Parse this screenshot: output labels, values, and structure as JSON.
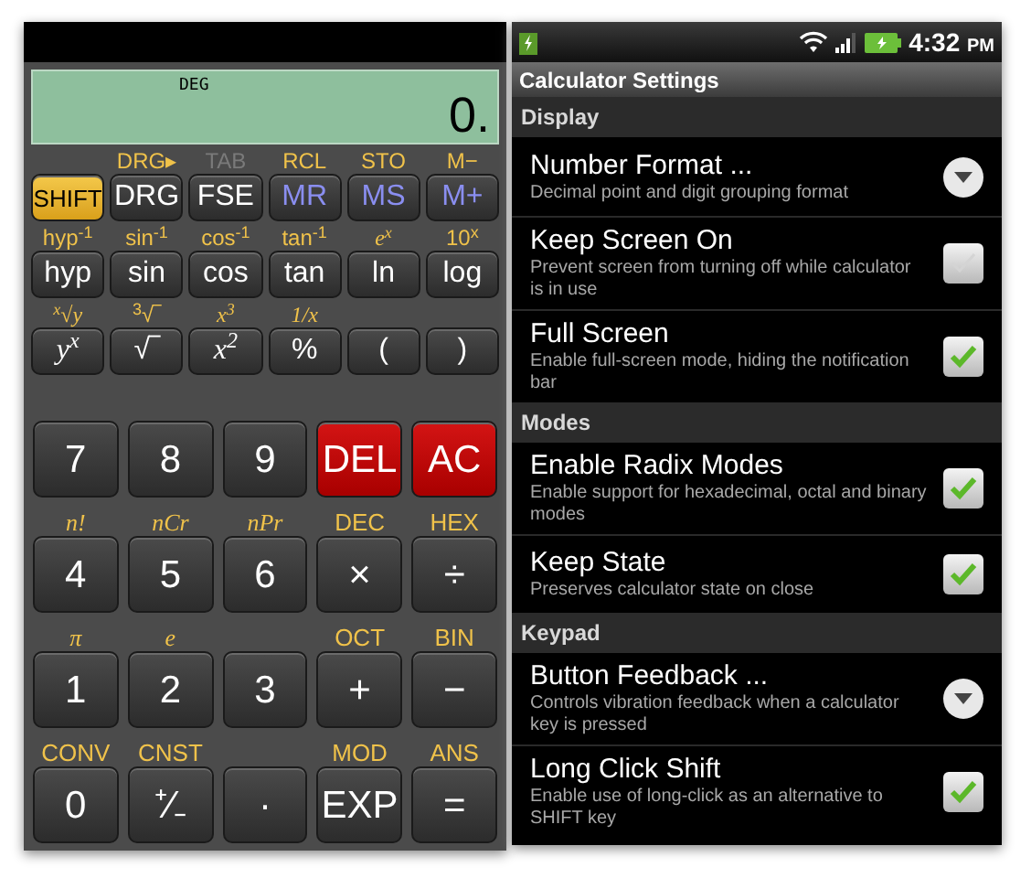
{
  "calculator": {
    "display": {
      "mode": "DEG",
      "value": "0."
    },
    "function_keys": [
      {
        "label": "SHIFT",
        "kind": "shift",
        "italic": false
      },
      {
        "label": "DRG",
        "kind": "plain",
        "italic": false,
        "alt": {
          "text": "DRG▸",
          "italic": false,
          "disabled": false
        }
      },
      {
        "label": "FSE",
        "kind": "plain",
        "italic": false,
        "alt": {
          "text": "TAB",
          "italic": false,
          "disabled": true
        }
      },
      {
        "label": "MR",
        "kind": "memory",
        "italic": false,
        "alt": {
          "text": "RCL",
          "italic": false,
          "disabled": false
        }
      },
      {
        "label": "MS",
        "kind": "memory",
        "italic": false,
        "alt": {
          "text": "STO",
          "italic": false,
          "disabled": false
        }
      },
      {
        "label": "M+",
        "kind": "memory",
        "italic": false,
        "alt": {
          "text": "M−",
          "italic": false,
          "disabled": false
        }
      },
      {
        "label": "hyp",
        "kind": "plain",
        "italic": false,
        "alt": {
          "text": "hyp$^{-1}$",
          "italic": false,
          "disabled": false
        }
      },
      {
        "label": "sin",
        "kind": "plain",
        "italic": false,
        "alt": {
          "text": "sin$^{-1}$",
          "italic": false,
          "disabled": false
        }
      },
      {
        "label": "cos",
        "kind": "plain",
        "italic": false,
        "alt": {
          "text": "cos$^{-1}$",
          "italic": false,
          "disabled": false
        }
      },
      {
        "label": "tan",
        "kind": "plain",
        "italic": false,
        "alt": {
          "text": "tan$^{-1}$",
          "italic": false,
          "disabled": false
        }
      },
      {
        "label": "ln",
        "kind": "plain",
        "italic": false,
        "alt": {
          "text": "e$^{x}$",
          "italic": true,
          "disabled": false
        }
      },
      {
        "label": "log",
        "kind": "plain",
        "italic": false,
        "alt": {
          "text": "10$^{x}$",
          "italic": false,
          "disabled": false
        }
      },
      {
        "label": "y$^{x}$",
        "kind": "plain",
        "italic": true,
        "alt": {
          "text": "$^{x}$√y",
          "italic": true,
          "disabled": false
        }
      },
      {
        "label": "√‾",
        "kind": "plain",
        "italic": false,
        "alt": {
          "text": "$^{3}$√‾",
          "italic": false,
          "disabled": false
        }
      },
      {
        "label": "x$^{2}$",
        "kind": "plain",
        "italic": true,
        "alt": {
          "text": "x$^{3}$",
          "italic": true,
          "disabled": false
        }
      },
      {
        "label": "%",
        "kind": "plain",
        "italic": false,
        "alt": {
          "text": "1/x",
          "italic": true,
          "disabled": false
        }
      },
      {
        "label": "(",
        "kind": "plain",
        "italic": false
      },
      {
        "label": ")",
        "kind": "plain",
        "italic": false
      }
    ],
    "number_keys": [
      {
        "label": "7",
        "kind": "plain",
        "italic": false
      },
      {
        "label": "8",
        "kind": "plain",
        "italic": false
      },
      {
        "label": "9",
        "kind": "plain",
        "italic": false
      },
      {
        "label": "DEL",
        "kind": "clear",
        "italic": false
      },
      {
        "label": "AC",
        "kind": "clear",
        "italic": false
      },
      {
        "label": "4",
        "kind": "plain",
        "italic": false,
        "alt": {
          "text": "n!",
          "italic": true,
          "disabled": false
        }
      },
      {
        "label": "5",
        "kind": "plain",
        "italic": false,
        "alt": {
          "text": "nCr",
          "italic": true,
          "disabled": false
        }
      },
      {
        "label": "6",
        "kind": "plain",
        "italic": false,
        "alt": {
          "text": "nPr",
          "italic": true,
          "disabled": false
        }
      },
      {
        "label": "×",
        "kind": "plain",
        "italic": false,
        "alt": {
          "text": "DEC",
          "italic": false,
          "disabled": false
        }
      },
      {
        "label": "÷",
        "kind": "plain",
        "italic": false,
        "alt": {
          "text": "HEX",
          "italic": false,
          "disabled": false
        }
      },
      {
        "label": "1",
        "kind": "plain",
        "italic": false,
        "alt": {
          "text": "π",
          "italic": true,
          "disabled": false
        }
      },
      {
        "label": "2",
        "kind": "plain",
        "italic": false,
        "alt": {
          "text": "e",
          "italic": true,
          "disabled": false
        }
      },
      {
        "label": "3",
        "kind": "plain",
        "italic": false
      },
      {
        "label": "+",
        "kind": "plain",
        "italic": false,
        "alt": {
          "text": "OCT",
          "italic": false,
          "disabled": false
        }
      },
      {
        "label": "−",
        "kind": "plain",
        "italic": false,
        "alt": {
          "text": "BIN",
          "italic": false,
          "disabled": false
        }
      },
      {
        "label": "0",
        "kind": "plain",
        "italic": false,
        "alt": {
          "text": "CONV",
          "italic": false,
          "disabled": false
        }
      },
      {
        "label": "⁺∕₋",
        "kind": "plain",
        "italic": false,
        "alt": {
          "text": "CNST",
          "italic": false,
          "disabled": false
        }
      },
      {
        "label": "·",
        "kind": "plain",
        "italic": false
      },
      {
        "label": "EXP",
        "kind": "plain",
        "italic": false,
        "alt": {
          "text": "MOD",
          "italic": false,
          "disabled": false
        }
      },
      {
        "label": "=",
        "kind": "plain",
        "italic": false,
        "alt": {
          "text": "ANS",
          "italic": false,
          "disabled": false
        }
      }
    ]
  },
  "settings": {
    "status_bar": {
      "time": "4:32",
      "meridiem": "PM"
    },
    "title": "Calculator Settings",
    "sections": [
      {
        "header": "Display",
        "items": [
          {
            "title": "Number Format ...",
            "summary": "Decimal point and digit grouping format",
            "kind": "list"
          },
          {
            "title": "Keep Screen On",
            "summary": "Prevent screen from turning off while calculator is in use",
            "kind": "checkbox",
            "checked": false
          },
          {
            "title": "Full Screen",
            "summary": "Enable full-screen mode, hiding the notification bar",
            "kind": "checkbox",
            "checked": true
          }
        ]
      },
      {
        "header": "Modes",
        "items": [
          {
            "title": "Enable Radix Modes",
            "summary": "Enable support for hexadecimal, octal and binary modes",
            "kind": "checkbox",
            "checked": true
          },
          {
            "title": "Keep State",
            "summary": "Preserves calculator state on close",
            "kind": "checkbox",
            "checked": true
          }
        ]
      },
      {
        "header": "Keypad",
        "items": [
          {
            "title": "Button Feedback ...",
            "summary": "Controls vibration feedback when a calculator key is pressed",
            "kind": "list"
          },
          {
            "title": "Long Click Shift",
            "summary": "Enable use of long-click as an alternative to SHIFT key",
            "kind": "checkbox",
            "checked": true
          }
        ]
      }
    ]
  }
}
